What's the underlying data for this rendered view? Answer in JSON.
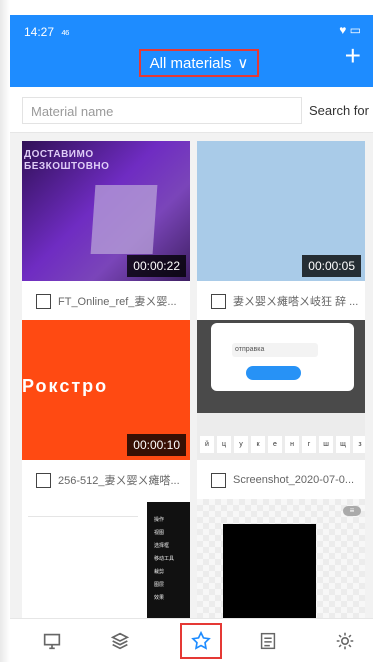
{
  "status_bar": {
    "time": "14:27",
    "signal": "₄₆",
    "right": "♥ ▭"
  },
  "header": {
    "title": "All materials",
    "chevron": "∨",
    "add": "+"
  },
  "search": {
    "placeholder": "Material name",
    "button": "Search for"
  },
  "materials": [
    {
      "name": "FT_Online_ref_妻ㄨ婴...",
      "duration": "00:00:22",
      "thumb_text": "ДОСТАВИМО\nБЕЗКОШТОВНО"
    },
    {
      "name": "妻ㄨ婴ㄨ瘫嗒ㄨ岐狂 辞 ...",
      "duration": "00:00:05"
    },
    {
      "name": "256-512_妻ㄨ婴ㄨ瘫嗒...",
      "duration": "00:00:10",
      "thumb_text": "Рокстро"
    },
    {
      "name": "Screenshot_2020-07-0...",
      "dialog_text": "отправка"
    },
    {
      "menu_lines": [
        "操作",
        "视图",
        "选择框",
        "移动工具",
        "裁剪",
        "图层",
        "效果"
      ]
    },
    {
      "pill": "≡"
    }
  ],
  "keyboard": [
    "й",
    "ц",
    "у",
    "к",
    "е",
    "н",
    "г",
    "ш",
    "щ",
    "з"
  ],
  "tabs": [
    "monitor-icon",
    "layers-icon",
    "star-icon",
    "list-icon",
    "gear-icon"
  ],
  "colors": {
    "accent": "#1e8cff",
    "highlight": "#e53935",
    "active_tab": "#1e8cff"
  }
}
